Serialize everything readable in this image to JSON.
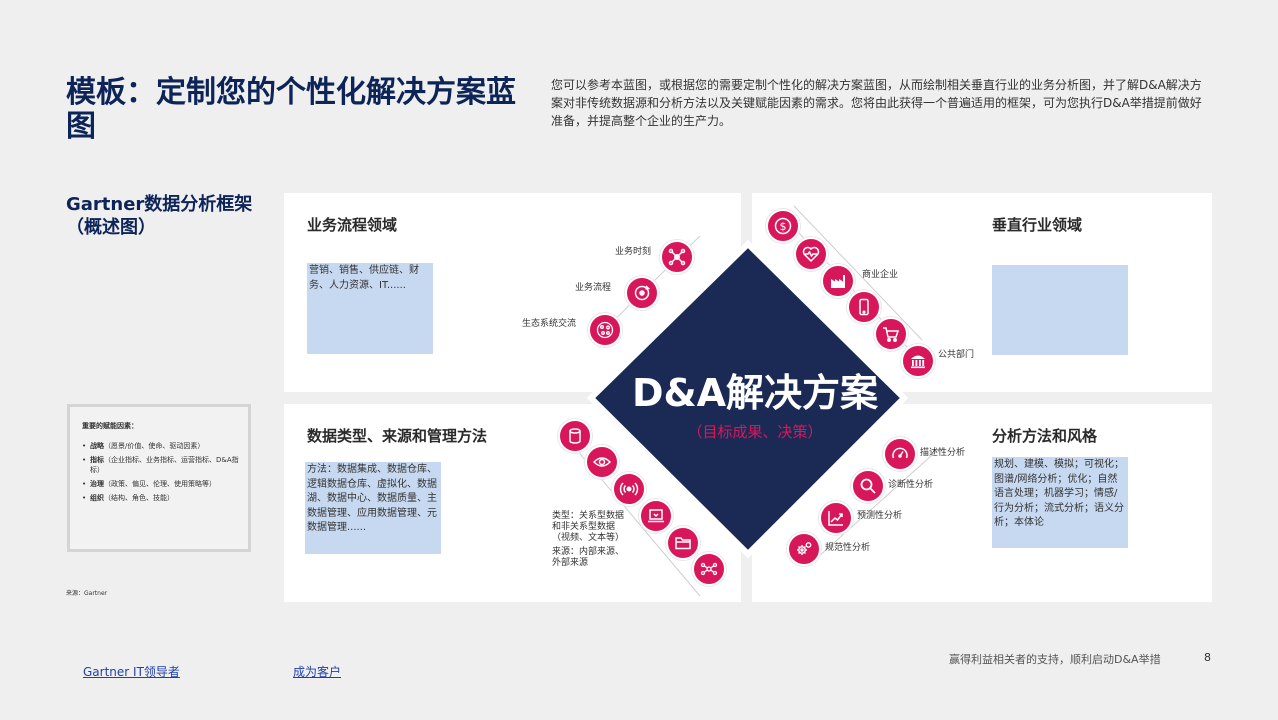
{
  "page": {
    "title": "模板：定制您的个性化解决方案蓝图",
    "intro": "您可以参考本蓝图，或根据您的需要定制个性化的解决方案蓝图，从而绘制相关垂直行业的业务分析图，并了解D&A解决方案对非传统数据源和分析方法以及关键赋能因素的需求。您将由此获得一个普遍适用的框架，可为您执行D&A举措提前做好准备，并提高整个企业的生产力。",
    "framework_title": "Gartner数据分析框架（概述图）",
    "source": "来源：Gartner"
  },
  "enablers": {
    "heading": "重要的赋能因素：",
    "items": [
      {
        "name": "战略",
        "text": "（愿景/价值、使命、驱动因素）"
      },
      {
        "name": "指标",
        "text": "（企业指标、业务指标、运营指标、D&A指标）"
      },
      {
        "name": "治理",
        "text": "（政策、偏见、伦理、使用策略等）"
      },
      {
        "name": "组织",
        "text": "（结构、角色、技能）"
      }
    ]
  },
  "center": {
    "title": "D&A解决方案",
    "subtitle": "（目标成果、决策）",
    "color": "#1b2a55"
  },
  "quadrants": {
    "business": {
      "title": "业务流程领域",
      "box": "营销、销售、供应链、财务、人力资源、IT......",
      "labels": [
        "业务时刻",
        "业务流程",
        "生态系统交流"
      ]
    },
    "vertical": {
      "title": "垂直行业领域",
      "box": "",
      "labels": [
        "商业企业",
        "公共部门"
      ]
    },
    "data": {
      "title": "数据类型、来源和管理方法",
      "box": "方法：数据集成、数据仓库、逻辑数据仓库、虚拟化、数据湖、数据中心、数据质量、主数据管理、应用数据管理、元数据管理......",
      "types": "类型：关系型数据和非关系型数据（视频、文本等）",
      "sources": "来源：内部来源、外部来源"
    },
    "analytics": {
      "title": "分析方法和风格",
      "box": "规划、建模、模拟；可视化；图谱/网络分析；优化；自然语言处理；机器学习；情感/行为分析；流式分析；语义分析；本体论",
      "labels": [
        "描述性分析",
        "诊断性分析",
        "预测性分析",
        "规范性分析"
      ]
    }
  },
  "icons": {
    "business": [
      "network-icon",
      "process-cycle-icon",
      "ecosystem-globe-icon"
    ],
    "vertical": [
      "dollar-icon",
      "heart-icon",
      "factory-icon",
      "mobile-icon",
      "cart-icon",
      "government-icon"
    ],
    "data": [
      "database-icon",
      "eye-icon",
      "signal-icon",
      "laptop-icon",
      "folder-icon",
      "nodes-icon"
    ],
    "analytics": [
      "gauge-icon",
      "magnifier-icon",
      "trend-chart-icon",
      "gears-icon"
    ]
  },
  "colors": {
    "accent": "#d8175b",
    "navy": "#0d2458",
    "box_blue": "#c7d9f0"
  },
  "footer": {
    "link1": "Gartner IT领导者",
    "link2": "成为客户",
    "tagline": "赢得利益相关者的支持，顺利启动D&A举措",
    "page_number": "8"
  }
}
